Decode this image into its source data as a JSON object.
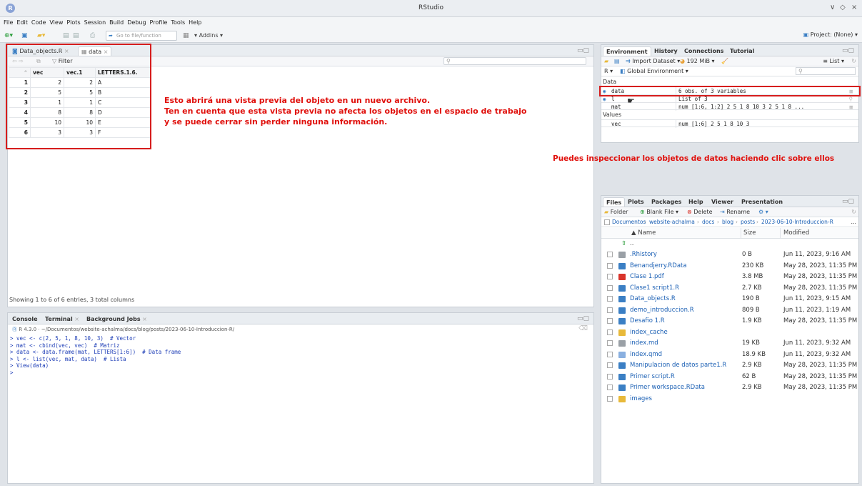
{
  "window": {
    "title": "RStudio",
    "controls": [
      "∨",
      "◇",
      "×"
    ]
  },
  "menu": [
    "File",
    "Edit",
    "Code",
    "View",
    "Plots",
    "Session",
    "Build",
    "Debug",
    "Profile",
    "Tools",
    "Help"
  ],
  "toolbar": {
    "goto_placeholder": "Go to file/function",
    "addins": "Addins",
    "project": "Project: (None)"
  },
  "source": {
    "tabs": [
      {
        "label": "Data_objects.R"
      },
      {
        "label": "data"
      }
    ],
    "filter": "Filter",
    "columns": [
      "vec",
      "vec.1",
      "LETTERS.1.6."
    ],
    "rows": [
      [
        "1",
        "2",
        "2",
        "A"
      ],
      [
        "2",
        "5",
        "5",
        "B"
      ],
      [
        "3",
        "1",
        "1",
        "C"
      ],
      [
        "4",
        "8",
        "8",
        "D"
      ],
      [
        "5",
        "10",
        "10",
        "E"
      ],
      [
        "6",
        "3",
        "3",
        "F"
      ]
    ],
    "status": "Showing 1 to 6 of 6 entries, 3 total columns"
  },
  "annotations": {
    "line1": "Esto abrirá una vista previa del objeto en un nuevo archivo.",
    "line2": "Ten en cuenta que esta vista previa no afecta los objetos en el espacio de trabajo",
    "line3": "y se puede cerrar sin perder ninguna información.",
    "env_note": "Puedes inspeccionar los objetos de datos haciendo clic sobre ellos"
  },
  "console": {
    "tabs": [
      "Console",
      "Terminal",
      "Background Jobs"
    ],
    "path": "R 4.3.0 · ~/Documentos/website-achalma/docs/blog/posts/2023-06-10-Introduccion-R/",
    "lines": [
      "> vec <- c(2, 5, 1, 8, 10, 3)  # Vector",
      "> mat <- cbind(vec, vec)  # Matriz",
      "> data <- data.frame(mat, LETTERS[1:6])  # Data frame",
      "> l <- list(vec, mat, data)  # Lista",
      "> View(data)",
      "> "
    ]
  },
  "environment": {
    "tabs": [
      "Environment",
      "History",
      "Connections",
      "Tutorial"
    ],
    "import": "Import Dataset",
    "memory": "192 MiB",
    "list_view": "List",
    "lang": "R",
    "scope": "Global Environment",
    "section_data": "Data",
    "section_values": "Values",
    "data": [
      {
        "name": "data",
        "value": "6 obs. of 3 variables"
      },
      {
        "name": "l",
        "value": "List of  3"
      },
      {
        "name": "mat",
        "value": "num [1:6, 1:2] 2 5 1 8 10 3 2 5 1 8 ..."
      }
    ],
    "values": [
      {
        "name": "vec",
        "value": "num [1:6] 2 5 1 8 10 3"
      }
    ]
  },
  "files": {
    "tabs": [
      "Files",
      "Plots",
      "Packages",
      "Help",
      "Viewer",
      "Presentation"
    ],
    "toolbar": [
      "Folder",
      "Blank File",
      "Delete",
      "Rename"
    ],
    "breadcrumb": [
      "Documentos",
      "website-achalma",
      "docs",
      "blog",
      "posts",
      "2023-06-10-Introduccion-R"
    ],
    "headers": [
      "Name",
      "Size",
      "Modified"
    ],
    "up": "..",
    "items": [
      {
        "name": ".Rhistory",
        "size": "0 B",
        "modified": "Jun 11, 2023, 9:16 AM",
        "icon": "#9aa0a6"
      },
      {
        "name": "Benandjerry.RData",
        "size": "230 KB",
        "modified": "May 28, 2023, 11:35 PM",
        "icon": "#3b7fc4"
      },
      {
        "name": "Clase 1.pdf",
        "size": "3.8 MB",
        "modified": "May 28, 2023, 11:35 PM",
        "icon": "#d9342b"
      },
      {
        "name": "Clase1 script1.R",
        "size": "2.7 KB",
        "modified": "May 28, 2023, 11:35 PM",
        "icon": "#3b7fc4"
      },
      {
        "name": "Data_objects.R",
        "size": "190 B",
        "modified": "Jun 11, 2023, 9:15 AM",
        "icon": "#3b7fc4"
      },
      {
        "name": "demo_introduccion.R",
        "size": "809 B",
        "modified": "Jun 11, 2023, 1:19 AM",
        "icon": "#3b7fc4"
      },
      {
        "name": "Desafio 1.R",
        "size": "1.9 KB",
        "modified": "May 28, 2023, 11:35 PM",
        "icon": "#3b7fc4"
      },
      {
        "name": "index_cache",
        "size": "",
        "modified": "",
        "icon": "#e8b93a"
      },
      {
        "name": "index.md",
        "size": "19 KB",
        "modified": "Jun 11, 2023, 9:32 AM",
        "icon": "#9aa0a6"
      },
      {
        "name": "index.qmd",
        "size": "18.9 KB",
        "modified": "Jun 11, 2023, 9:32 AM",
        "icon": "#8ab0e0"
      },
      {
        "name": "Manipulacion de datos parte1.R",
        "size": "2.9 KB",
        "modified": "May 28, 2023, 11:35 PM",
        "icon": "#3b7fc4"
      },
      {
        "name": "Primer script.R",
        "size": "62 B",
        "modified": "May 28, 2023, 11:35 PM",
        "icon": "#3b7fc4"
      },
      {
        "name": "Primer workspace.RData",
        "size": "2.9 KB",
        "modified": "May 28, 2023, 11:35 PM",
        "icon": "#3b7fc4"
      },
      {
        "name": "images",
        "size": "",
        "modified": "",
        "icon": "#e8b93a"
      }
    ]
  }
}
